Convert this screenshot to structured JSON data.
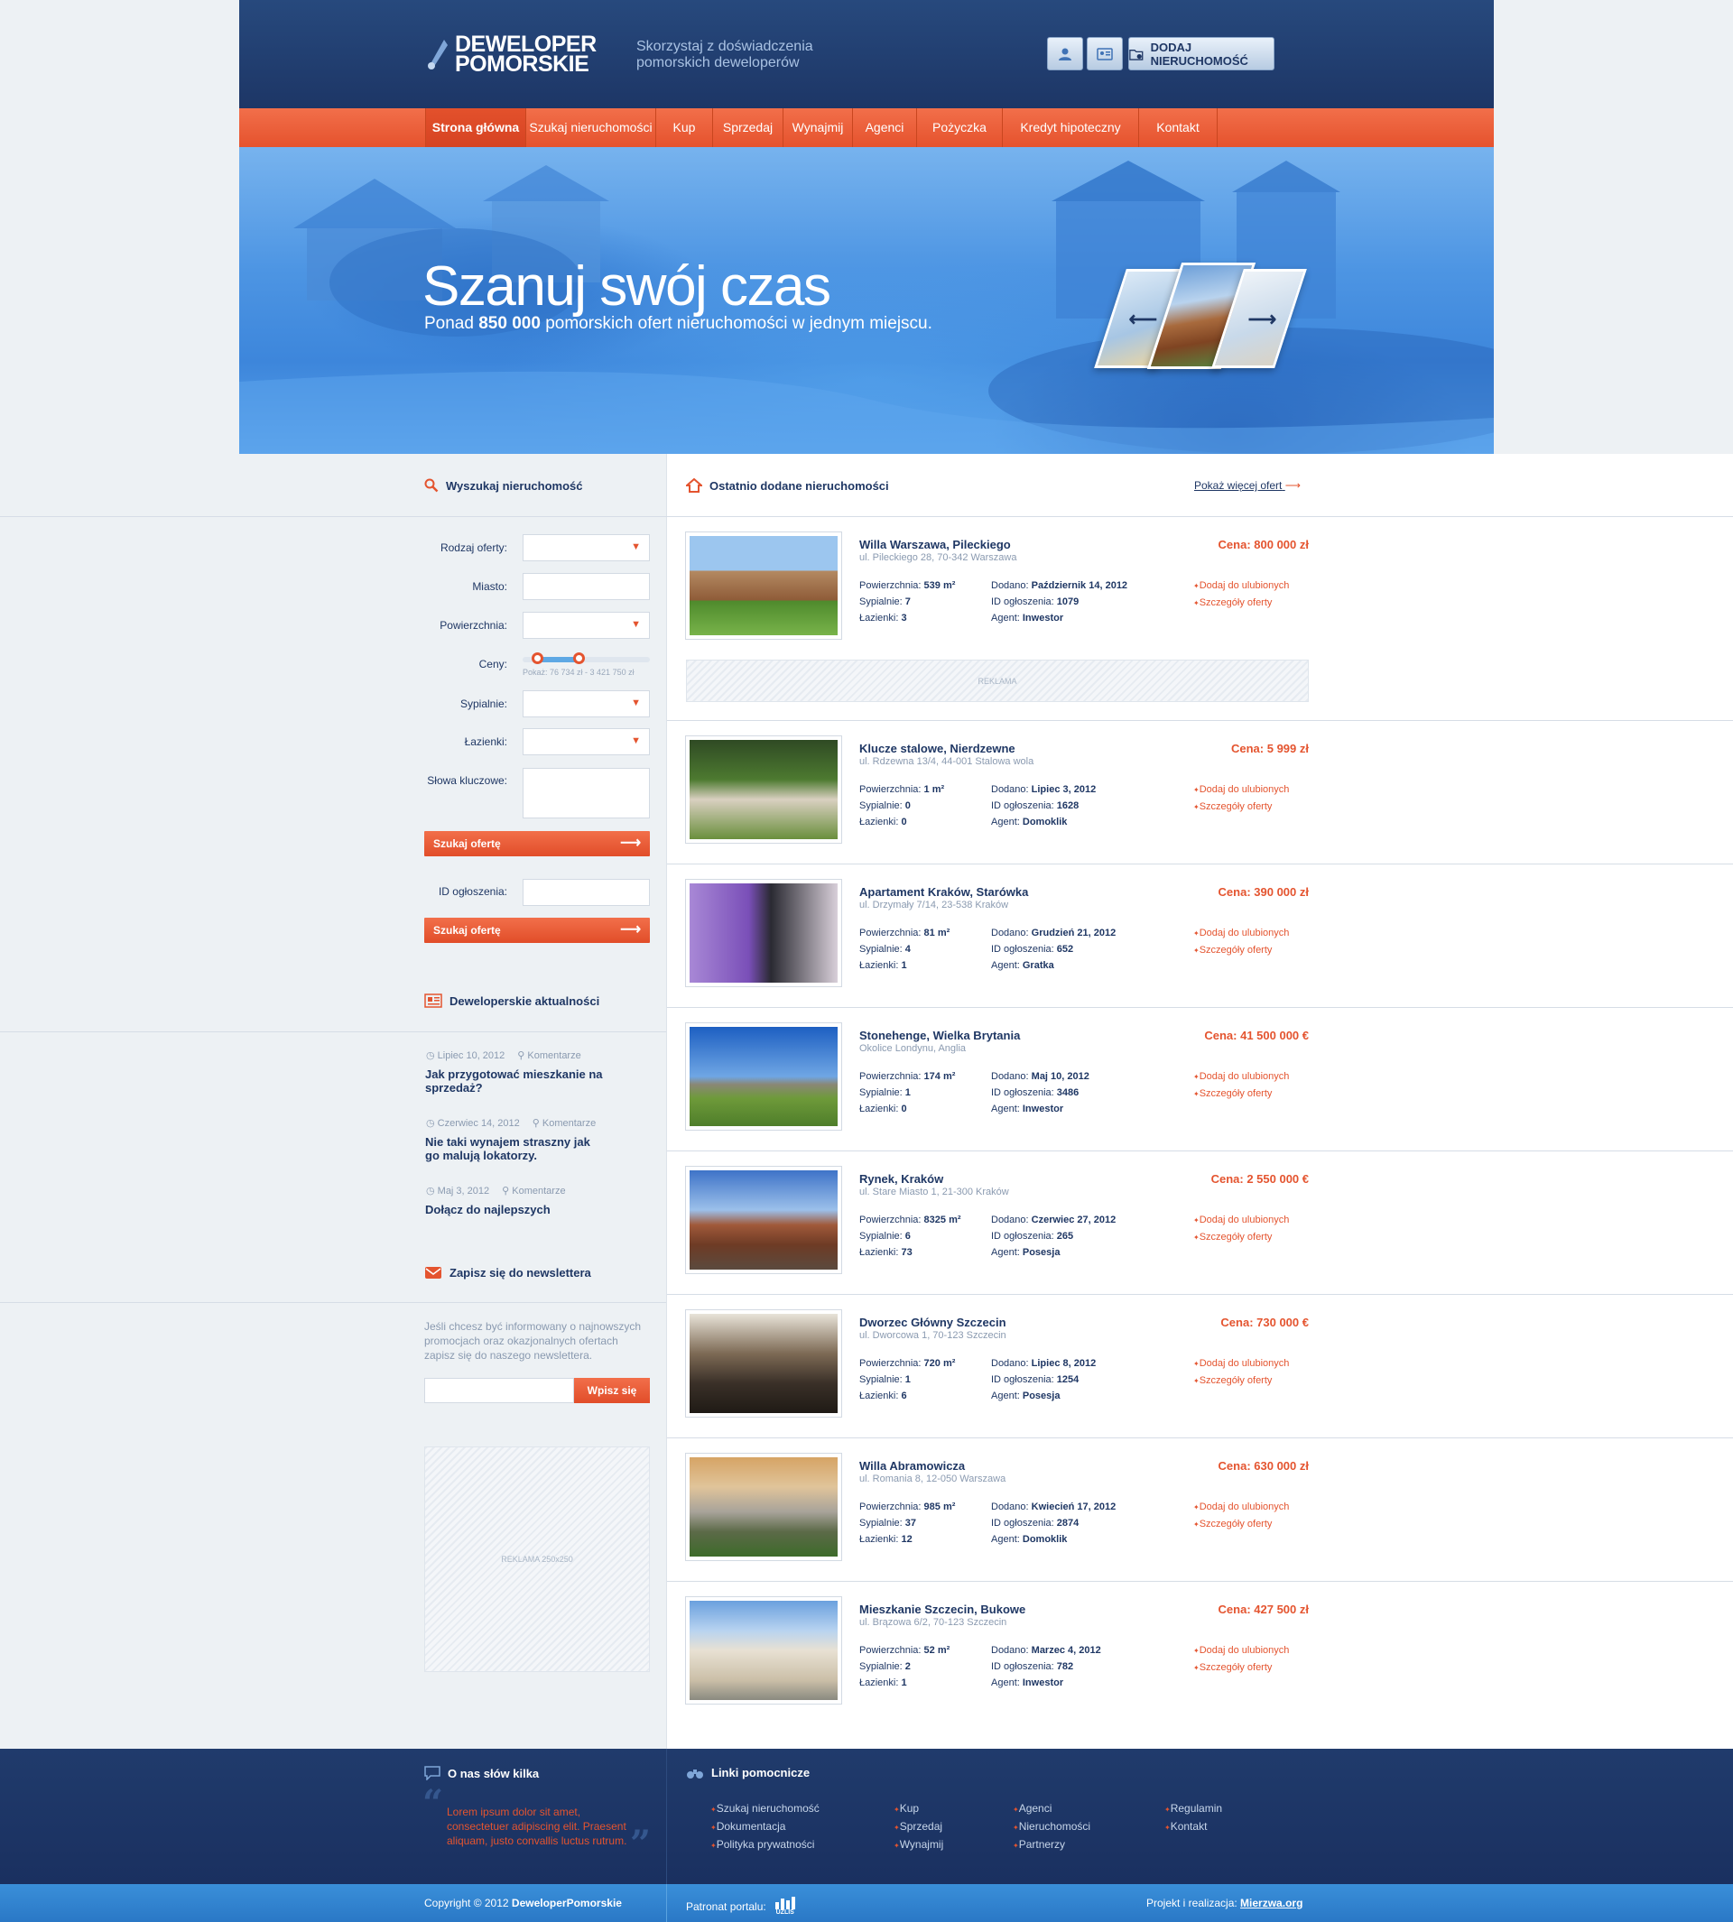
{
  "header": {
    "logo_line1": "DEWELOPER",
    "logo_line2": "POMORSKIE",
    "tagline_line1": "Skorzystaj z doświadczenia",
    "tagline_line2": "pomorskich deweloperów",
    "add_button": "DODAJ NIERUCHOMOŚĆ"
  },
  "nav": {
    "items": [
      "Strona główna",
      "Szukaj nieruchomości",
      "Kup",
      "Sprzedaj",
      "Wynajmij",
      "Agenci",
      "Pożyczka",
      "Kredyt hipoteczny",
      "Kontakt"
    ]
  },
  "hero": {
    "title": "Szanuj swój czas",
    "sub_pre": "Ponad ",
    "sub_bold": "850 000",
    "sub_post": " pomorskich ofert nieruchomości w jednym miejscu.",
    "prev_arrow": "⟵",
    "next_arrow": "⟶"
  },
  "search": {
    "heading": "Wyszukaj nieruchomość",
    "labels": {
      "type": "Rodzaj oferty:",
      "city": "Miasto:",
      "area": "Powierzchnia:",
      "price": "Ceny:",
      "bedrooms": "Sypialnie:",
      "bathrooms": "Łazienki:",
      "keywords": "Słowa kluczowe:",
      "id": "ID ogłoszenia:"
    },
    "price_note": "Pokaż: 76 734 zł - 3 421 750 zł",
    "button": "Szukaj ofertę",
    "button_arrow": "⟶"
  },
  "news": {
    "heading": "Deweloperskie aktualności",
    "comments_label": "Komentarze",
    "items": [
      {
        "date": "Lipiec 10, 2012",
        "title": "Jak przygotować mieszkanie na sprzedaż?"
      },
      {
        "date": "Czerwiec 14, 2012",
        "title": "Nie taki wynajem straszny jak go malują lokatorzy."
      },
      {
        "date": "Maj 3, 2012",
        "title": "Dołącz do najlepszych"
      }
    ]
  },
  "newsletter": {
    "heading": "Zapisz się do newslettera",
    "text": "Jeśli chcesz być informowany o najnowszych promocjach oraz okazjonalnych ofertach zapisz się do naszego newslettera.",
    "button": "Wpisz się"
  },
  "ads": {
    "banner": "REKLAMA",
    "side": "REKLAMA 250x250"
  },
  "listings_section": {
    "heading": "Ostatnio dodane nieruchomości",
    "more_link": "Pokaż więcej ofert",
    "labels": {
      "area": "Powierzchnia:",
      "bedrooms": "Sypialnie:",
      "bathrooms": "Łazienki:",
      "added": "Dodano:",
      "id": "ID ogłoszenia:",
      "agent": "Agent:",
      "fav": "Dodaj do ulubionych",
      "details": "Szczegóły oferty"
    }
  },
  "listings": [
    {
      "name": "Willa Warszawa, Pileckiego",
      "addr": "ul. Pileckiego 28, 70-342 Warszawa",
      "price": "Cena: 800 000 zł",
      "area": "539 m²",
      "bedrooms": "7",
      "bathrooms": "3",
      "added": "Październik 14, 2012",
      "id": "1079",
      "agent": "Inwestor"
    },
    {
      "name": "Klucze stalowe, Nierdzewne",
      "addr": "ul. Rdzewna 13/4, 44-001 Stalowa wola",
      "price": "Cena: 5 999 zł",
      "area": "1 m²",
      "bedrooms": "0",
      "bathrooms": "0",
      "added": "Lipiec 3, 2012",
      "id": "1628",
      "agent": "Domoklik"
    },
    {
      "name": "Apartament Kraków, Starówka",
      "addr": "ul. Drzymały 7/14, 23-538 Kraków",
      "price": "Cena: 390 000 zł",
      "area": "81 m²",
      "bedrooms": "4",
      "bathrooms": "1",
      "added": "Grudzień 21, 2012",
      "id": "652",
      "agent": "Gratka"
    },
    {
      "name": "Stonehenge, Wielka Brytania",
      "addr": "Okolice Londynu, Anglia",
      "price": "Cena: 41 500 000 €",
      "area": "174 m²",
      "bedrooms": "1",
      "bathrooms": "0",
      "added": "Maj 10, 2012",
      "id": "3486",
      "agent": "Inwestor"
    },
    {
      "name": "Rynek, Kraków",
      "addr": "ul. Stare Miasto 1, 21-300 Kraków",
      "price": "Cena: 2 550 000 €",
      "area": "8325 m²",
      "bedrooms": "6",
      "bathrooms": "73",
      "added": "Czerwiec 27, 2012",
      "id": "265",
      "agent": "Posesja"
    },
    {
      "name": "Dworzec Główny Szczecin",
      "addr": "ul. Dworcowa 1, 70-123 Szczecin",
      "price": "Cena: 730 000 €",
      "area": "720 m²",
      "bedrooms": "1",
      "bathrooms": "6",
      "added": "Lipiec 8, 2012",
      "id": "1254",
      "agent": "Posesja"
    },
    {
      "name": "Willa Abramowicza",
      "addr": "ul. Romania 8, 12-050 Warszawa",
      "price": "Cena: 630 000 zł",
      "area": "985 m²",
      "bedrooms": "37",
      "bathrooms": "12",
      "added": "Kwiecień 17, 2012",
      "id": "2874",
      "agent": "Domoklik"
    },
    {
      "name": "Mieszkanie Szczecin, Bukowe",
      "addr": "ul. Brązowa 6/2, 70-123 Szczecin",
      "price": "Cena: 427 500 zł",
      "area": "52 m²",
      "bedrooms": "2",
      "bathrooms": "1",
      "added": "Marzec 4, 2012",
      "id": "782",
      "agent": "Inwestor"
    }
  ],
  "footer": {
    "about_heading": "O nas słów kilka",
    "about_text": "Lorem ipsum dolor sit amet, consectetuer adipiscing elit. Praesent aliquam, justo convallis luctus rutrum.",
    "links_heading": "Linki pomocnicze",
    "links_col1": [
      "Szukaj nieruchomość",
      "Dokumentacja",
      "Polityka prywatności"
    ],
    "links_col2": [
      "Kup",
      "Sprzedaj",
      "Wynajmij"
    ],
    "links_col3": [
      "Agenci",
      "Nieruchomości",
      "Partnerzy"
    ],
    "links_col4": [
      "Regulamin",
      "Kontakt"
    ],
    "copyright_pre": "Copyright © 2012 ",
    "copyright_brand": "DeweloperPomorskie",
    "patronat": "Patronat portalu:",
    "patron_logo": "UZLIS",
    "credit_pre": "Projekt i realizacja: ",
    "credit_link": "Mierzwa.org"
  },
  "colors": {
    "navy": "#1d3666",
    "accent": "#e4542f",
    "sky": "#4d95e3"
  }
}
